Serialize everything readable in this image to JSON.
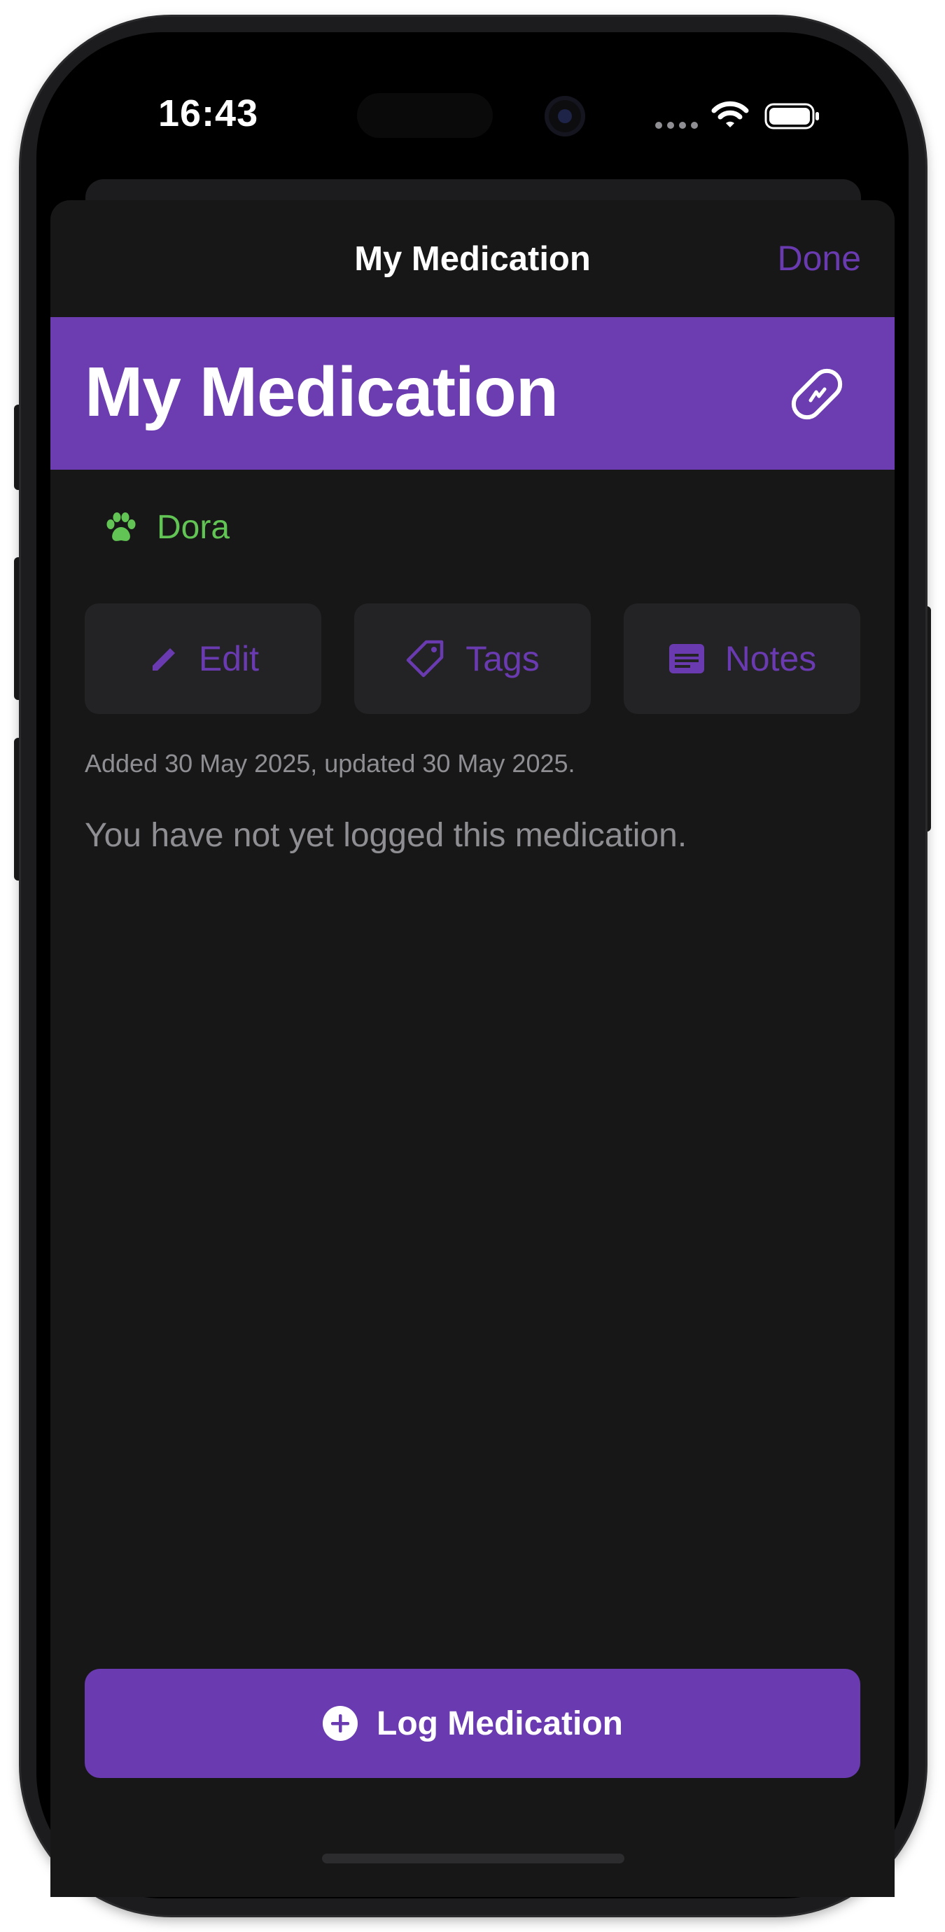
{
  "status_bar": {
    "time": "16:43"
  },
  "nav": {
    "title": "My Medication",
    "done_label": "Done"
  },
  "header": {
    "title": "My Medication",
    "icon": "pill-icon",
    "color": "#6b3db0"
  },
  "pet": {
    "name": "Dora",
    "icon": "paw-icon",
    "color": "#62c454"
  },
  "actions": [
    {
      "label": "Edit",
      "icon": "pencil-icon"
    },
    {
      "label": "Tags",
      "icon": "tag-icon"
    },
    {
      "label": "Notes",
      "icon": "note-icon"
    }
  ],
  "meta": "Added 30 May 2025, updated 30 May 2025.",
  "empty_state": "You have not yet logged this medication.",
  "log_button": {
    "label": "Log Medication",
    "icon": "plus-circle-icon"
  },
  "colors": {
    "accent": "#6a3bb0",
    "sheet_bg": "#171717",
    "button_bg": "#232325",
    "secondary_text": "#8e8e93"
  }
}
